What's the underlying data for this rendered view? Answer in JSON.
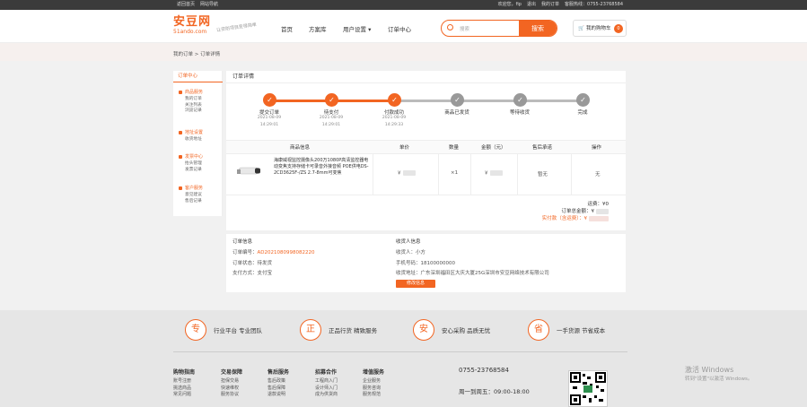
{
  "topbar": {
    "left": [
      "返回首页",
      "网站导航"
    ],
    "right": [
      "欢迎您，fip",
      "退出",
      "我的订单",
      "客服热线：0755-23768584"
    ]
  },
  "logo": {
    "main": "安豆网",
    "domain": "51ando.com",
    "slogan": "让安防项目变得简单"
  },
  "nav": [
    "首页",
    "方案库",
    "用户设置",
    "订单中心"
  ],
  "search": {
    "placeholder": "搜索",
    "button": "搜索"
  },
  "cart": {
    "label": "我的购物车",
    "count": "0"
  },
  "breadcrumb": "我的订单 > 订单详情",
  "sidebar": {
    "title": "订单中心",
    "groups": [
      {
        "title": "商品服务",
        "items": [
          "我的订单",
          "关注列表",
          "浏览记录"
        ]
      },
      {
        "title": "地址设置",
        "items": [
          "收货地址"
        ]
      },
      {
        "title": "发票中心",
        "items": [
          "抬头管理",
          "发票记录"
        ]
      },
      {
        "title": "客户服务",
        "items": [
          "意见建议",
          "售后记录"
        ]
      }
    ]
  },
  "detail": {
    "title": "订单详情",
    "steps": [
      {
        "label": "提交订单",
        "date": "2021-08-09",
        "time": "14:29:01",
        "done": true
      },
      {
        "label": "待支付",
        "date": "2021-08-09",
        "time": "14:29:01",
        "done": true
      },
      {
        "label": "付款成功",
        "date": "2021-08-09",
        "time": "14:29:33",
        "done": true
      },
      {
        "label": "商品已发货",
        "date": "",
        "time": "",
        "done": false
      },
      {
        "label": "等待收货",
        "date": "",
        "time": "",
        "done": false
      },
      {
        "label": "完成",
        "date": "",
        "time": "",
        "done": false
      }
    ],
    "headers": [
      "商品信息",
      "单价",
      "数量",
      "金额（元）",
      "售后承诺",
      "操作"
    ],
    "item": {
      "name": "海康威视监控摄像头200万1080P高清监控器电动变焦支持存储卡可录音外接音频 POE供电DS-2CD3625F-/ZS 2.7-8mm可变焦",
      "unit_price": "¥",
      "qty": "×1",
      "amount": "¥",
      "after_sale": "暂无",
      "op": "无"
    },
    "totals": {
      "freight": "运费：¥0",
      "order_total": "订单总金额：¥",
      "paid": "实付款（含运费）：¥"
    },
    "colors": {
      "accent": "#f26522",
      "inactive": "#999999"
    }
  },
  "order_info": {
    "title": "订单信息",
    "no_label": "订单编号：",
    "no": "AD2021080998082220",
    "status": "订单状态：待发货",
    "pay": "支付方式：支付宝"
  },
  "receiver": {
    "title": "收货人信息",
    "name": "收货人：小方",
    "phone": "手机号码：18100000000",
    "address": "收货地址：广东深圳福田区大庆大厦25G深圳市安豆网络技术有限公司",
    "button": "修改信息"
  },
  "footer": {
    "promises": [
      {
        "icon": "专",
        "text": "行业平台 专业团队"
      },
      {
        "icon": "正",
        "text": "正品行货 精致服务"
      },
      {
        "icon": "安",
        "text": "安心采购 品质无忧"
      },
      {
        "icon": "省",
        "text": "一手货源 节省成本"
      }
    ],
    "columns": [
      {
        "h": "购物指南",
        "items": [
          "账号注册",
          "挑选商品",
          "常见问题"
        ]
      },
      {
        "h": "交易保障",
        "items": [
          "担保交易",
          "快速维权",
          "服务协议"
        ]
      },
      {
        "h": "售后服务",
        "items": [
          "售后政策",
          "售后保障",
          "退款说明"
        ]
      },
      {
        "h": "招募合作",
        "items": [
          "工程商入门",
          "设计师入门",
          "成为供货商"
        ]
      },
      {
        "h": "增值服务",
        "items": [
          "企业服务",
          "服务咨询",
          "服务规范"
        ]
      }
    ],
    "phone": "0755-23768584",
    "hours": "周一到周五：09:00-18:00"
  },
  "watermark": {
    "line1": "激活 Windows",
    "line2": "转到\"设置\"以激活 Windows。"
  }
}
